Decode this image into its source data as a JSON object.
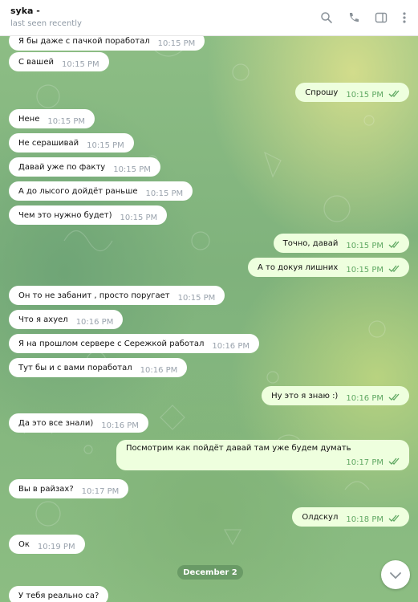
{
  "header": {
    "title": "syka -",
    "status": "last seen recently",
    "icons": [
      "search-icon",
      "phone-icon",
      "sidebar-toggle-icon",
      "more-icon"
    ]
  },
  "messages": [
    {
      "dir": "in",
      "text": "Я бы даже с пачкой поработал",
      "time": "10:15 PM"
    },
    {
      "dir": "in",
      "text": "С вашей",
      "time": "10:15 PM"
    },
    {
      "dir": "out",
      "text": "Спрошу",
      "time": "10:15 PM"
    },
    {
      "dir": "in",
      "text": "Нене",
      "time": "10:15 PM"
    },
    {
      "dir": "in",
      "text": "Не серашивай",
      "time": "10:15 PM"
    },
    {
      "dir": "in",
      "text": "Давай уже по факту",
      "time": "10:15 PM"
    },
    {
      "dir": "in",
      "text": "А до лысого дойдёт раньше",
      "time": "10:15 PM"
    },
    {
      "dir": "in",
      "text": "Чем это нужно будет)",
      "time": "10:15 PM"
    },
    {
      "dir": "out",
      "text": "Точно, давай",
      "time": "10:15 PM"
    },
    {
      "dir": "out",
      "text": "А то докуя лишних",
      "time": "10:15 PM"
    },
    {
      "dir": "in",
      "text": "Он то не забанит , просто поругает",
      "time": "10:15 PM"
    },
    {
      "dir": "in",
      "text": "Что я ахуел",
      "time": "10:16 PM"
    },
    {
      "dir": "in",
      "text": "Я на прошлом сервере с Сережкой работал",
      "time": "10:16 PM"
    },
    {
      "dir": "in",
      "text": "Тут бы и с вами поработал",
      "time": "10:16 PM"
    },
    {
      "dir": "out",
      "text": "Ну это я знаю :)",
      "time": "10:16 PM"
    },
    {
      "dir": "in",
      "text": "Да это все знали)",
      "time": "10:16 PM"
    },
    {
      "dir": "out",
      "text": "Посмотрим как пойдёт давай там уже будем думать",
      "time": "10:17 PM"
    },
    {
      "dir": "in",
      "text": "Вы в райзах?",
      "time": "10:17 PM"
    },
    {
      "dir": "out",
      "text": "Олдскул",
      "time": "10:18 PM"
    },
    {
      "dir": "in",
      "text": "Ок",
      "time": "10:19 PM"
    },
    {
      "dir": "in",
      "text": "У тебя реально са?",
      "time": ""
    }
  ],
  "date_divider": "December 2",
  "colors": {
    "incoming": "#ffffff",
    "outgoing": "#eeffde",
    "check": "#5fa862",
    "time": "#9aa3ad"
  }
}
